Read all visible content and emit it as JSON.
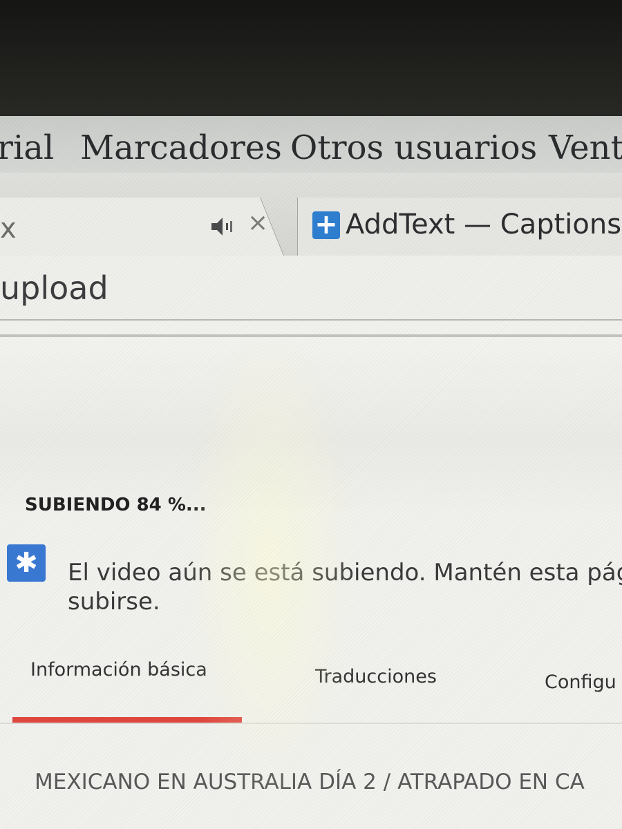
{
  "menubar": {
    "items": [
      {
        "label": "rial"
      },
      {
        "label": "Marcadores"
      },
      {
        "label": "Otros usuarios"
      },
      {
        "label": "Venta"
      }
    ]
  },
  "tabs": {
    "left_fragment": "x",
    "close_glyph": "×",
    "right_title": "AddText — Captions for",
    "audio_icon": "speaker-icon",
    "favicon_icon": "plus-icon"
  },
  "urlbar": {
    "text": "upload"
  },
  "upload": {
    "status": "SUBIENDO 84 %...",
    "progress_percent": 84,
    "message": "El video aún se está subiendo. Mantén esta pág subirse.",
    "info_icon": "asterisk-icon"
  },
  "detail_tabs": [
    {
      "label": "Información básica",
      "active": true
    },
    {
      "label": "Traducciones",
      "active": false
    },
    {
      "label": "Configu",
      "active": false
    }
  ],
  "video": {
    "title": "MEXICANO EN AUSTRALIA DÍA 2 / ATRAPADO EN CA"
  },
  "colors": {
    "accent_underline": "#e0473f",
    "favicon_blue": "#2f7fd0",
    "info_blue": "#3a79d3"
  }
}
